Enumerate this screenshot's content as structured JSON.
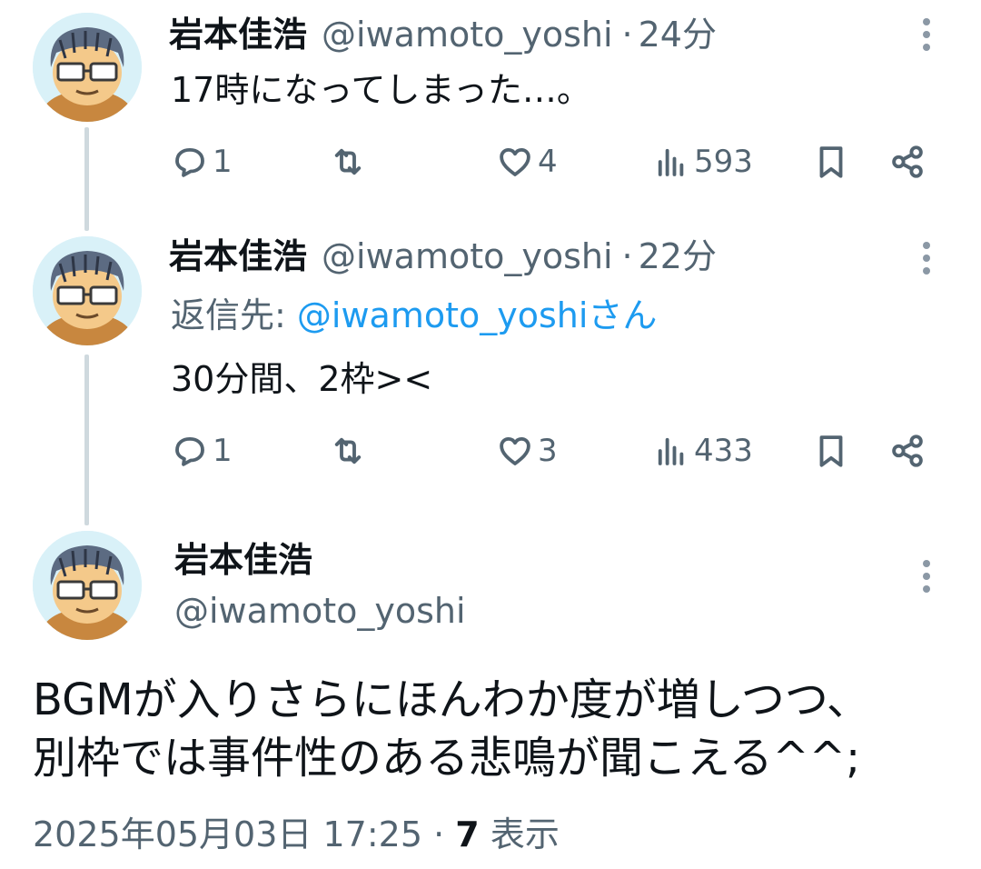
{
  "tweets": [
    {
      "name": "岩本佳浩",
      "handle": "@iwamoto_yoshi",
      "separator": "·",
      "time": "24分",
      "text": "17時になってしまった…。",
      "actions": {
        "replies": "1",
        "likes": "4",
        "views": "593"
      }
    },
    {
      "name": "岩本佳浩",
      "handle": "@iwamoto_yoshi",
      "separator": "·",
      "time": "22分",
      "reply_prefix": "返信先: ",
      "reply_target": "@iwamoto_yoshiさん",
      "text": "30分間、2枠><",
      "actions": {
        "replies": "1",
        "likes": "3",
        "views": "433"
      }
    }
  ],
  "main_tweet": {
    "name": "岩本佳浩",
    "handle": "@iwamoto_yoshi",
    "text_lines": [
      "BGMが入りさらにほんわか度が増しつつ、",
      "別枠では事件性のある悲鳴が聞こえる^^;"
    ],
    "timestamp": "2025年05月03日 17:25",
    "separator": "·",
    "views_count": "7",
    "views_label": "表示"
  },
  "icons": [
    "reply-icon",
    "retweet-icon",
    "like-icon",
    "views-icon",
    "bookmark-icon",
    "share-icon",
    "more-icon"
  ],
  "colors": {
    "text": "#0f1419",
    "secondary": "#536471",
    "link": "#1d9bf0",
    "thread_line": "#cfd9de"
  }
}
